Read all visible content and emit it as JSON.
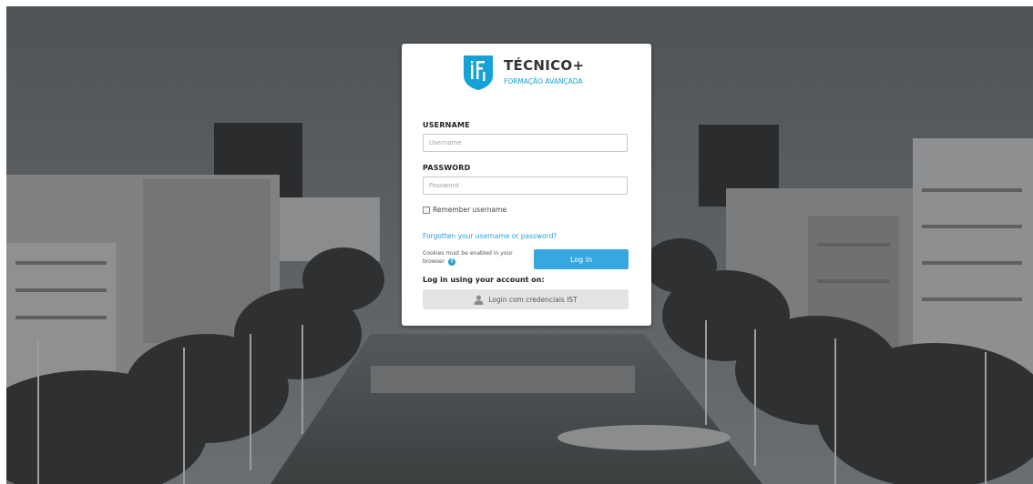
{
  "brand": {
    "title": "TÉCNICO+",
    "subtitle": "FORMAÇÃO AVANÇADA",
    "accent_color": "#16a2d6"
  },
  "form": {
    "username_label": "USERNAME",
    "username_placeholder": "Username",
    "username_value": "",
    "password_label": "PASSWORD",
    "password_placeholder": "Password",
    "password_value": "",
    "remember_label": "Remember username",
    "remember_checked": false,
    "forgot_link": "Forgotten your username or password?",
    "cookies_note": "Cookies must be enabled in your browser",
    "help_icon": "?",
    "login_button": "Log in",
    "login_button_color": "#38a7e0"
  },
  "alt_login": {
    "heading": "Log in using your account on:",
    "button_label": "Login com credenciais IST",
    "icon": "user-icon"
  }
}
